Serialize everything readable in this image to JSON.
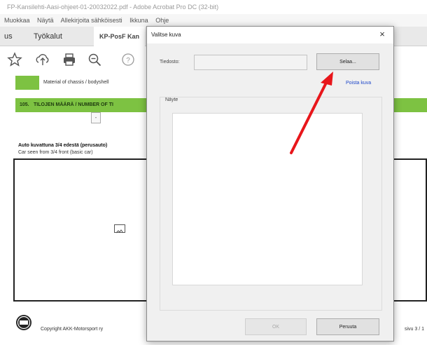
{
  "window": {
    "title": "FP-Kansilehti-Aasi-ohjeet-01-20032022.pdf - Adobe Acrobat Pro DC (32-bit)"
  },
  "menu": [
    "Muokkaa",
    "Näytä",
    "Allekirjoita sähköisesti",
    "Ikkuna",
    "Ohje"
  ],
  "tabs": {
    "left_stub": "us",
    "tools": "Työkalut",
    "document": "KP-PosF Kan"
  },
  "toolbar": {
    "icons": [
      "star-icon",
      "upload-icon",
      "print-icon",
      "zoom-icon",
      "help-icon"
    ]
  },
  "document": {
    "row_top_small": "Material of chassis / bodyshell",
    "row_section": "105.",
    "row_section_title": "TILOJEN MÄÄRÄ / NUMBER OF TI",
    "car_heading": "Auto kuvattuna 3/4 edestä (perusauto)",
    "car_subheading": "Car seen from 3/4 front (basic car)",
    "copyright": "Copyright AKK-Motorsport ry",
    "page_right": "sivu 3 / 1"
  },
  "dialog": {
    "title": "Valitse kuva",
    "close_glyph": "×",
    "file_label": "Tiedosto:",
    "file_value": "",
    "browse_button": "Selaa...",
    "remove_link": "Poista kuva",
    "preview_label": "Näyte",
    "ok_button": "OK",
    "cancel_button": "Peruuta"
  },
  "annotation": {
    "arrow_color": "#e8161b"
  },
  "colors": {
    "green_accent": "#7dc242",
    "link_blue": "#1e47c9"
  }
}
